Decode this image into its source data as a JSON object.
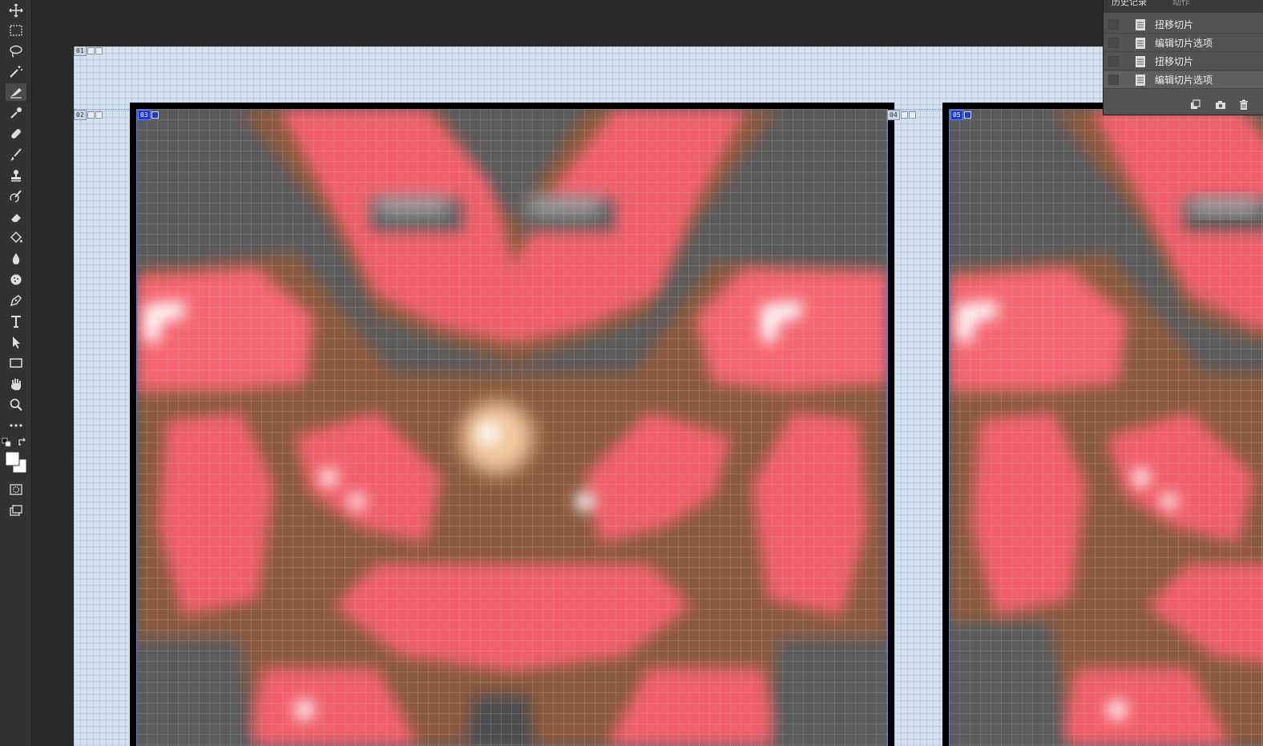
{
  "toolbar": {
    "tools": [
      {
        "name": "move-tool",
        "icon": "move-icon"
      },
      {
        "name": "marquee-tool",
        "icon": "rect-marquee-icon"
      },
      {
        "name": "lasso-tool",
        "icon": "lasso-icon"
      },
      {
        "name": "magic-wand-tool",
        "icon": "magic-wand-icon"
      },
      {
        "name": "slice-tool",
        "icon": "slice-icon",
        "active": true
      },
      {
        "name": "eyedropper-tool",
        "icon": "eyedropper-icon"
      },
      {
        "name": "healing-brush-tool",
        "icon": "bandage-icon"
      },
      {
        "name": "brush-tool",
        "icon": "brush-icon"
      },
      {
        "name": "clone-stamp-tool",
        "icon": "stamp-icon"
      },
      {
        "name": "history-brush-tool",
        "icon": "history-brush-icon"
      },
      {
        "name": "eraser-tool",
        "icon": "eraser-icon"
      },
      {
        "name": "paint-bucket-tool",
        "icon": "bucket-icon"
      },
      {
        "name": "blur-tool",
        "icon": "drop-icon"
      },
      {
        "name": "sponge-tool",
        "icon": "sponge-icon"
      },
      {
        "name": "pen-tool",
        "icon": "pen-icon"
      },
      {
        "name": "type-tool",
        "icon": "type-icon"
      },
      {
        "name": "path-selection-tool",
        "icon": "arrow-icon"
      },
      {
        "name": "rectangle-tool",
        "icon": "rectangle-icon"
      },
      {
        "name": "hand-tool",
        "icon": "hand-icon"
      },
      {
        "name": "zoom-tool",
        "icon": "zoom-icon"
      },
      {
        "name": "more-tools",
        "icon": "more-icon"
      }
    ],
    "quick_mask_icon": "quick-mask-icon",
    "screen_mode_icon": "screen-mode-icon",
    "foreground_color": "#ffffff",
    "background_color": "#ffffff"
  },
  "canvas": {
    "background_color": "#d3e1ef",
    "slices": [
      {
        "number": "01",
        "selected": false
      },
      {
        "number": "02",
        "selected": false
      },
      {
        "number": "03",
        "selected": true
      },
      {
        "number": "04",
        "selected": false
      },
      {
        "number": "05",
        "selected": true
      }
    ],
    "pixel_colors": {
      "red": "#f2606a",
      "light_red": "#ff7b82",
      "brown": "#8b5a3c",
      "gray": "#5a5a5a",
      "highlight": "#ffffff",
      "glow": "#f2c89a"
    }
  },
  "history_panel": {
    "tab_history": "历史记录",
    "tab_actions": "动作",
    "items": [
      {
        "label": "扭移切片",
        "current": false
      },
      {
        "label": "编辑切片选项",
        "current": false
      },
      {
        "label": "扭移切片",
        "current": false
      },
      {
        "label": "编辑切片选项",
        "current": true
      }
    ],
    "footer_icons": [
      "new-document-icon",
      "camera-icon",
      "trash-icon"
    ]
  }
}
